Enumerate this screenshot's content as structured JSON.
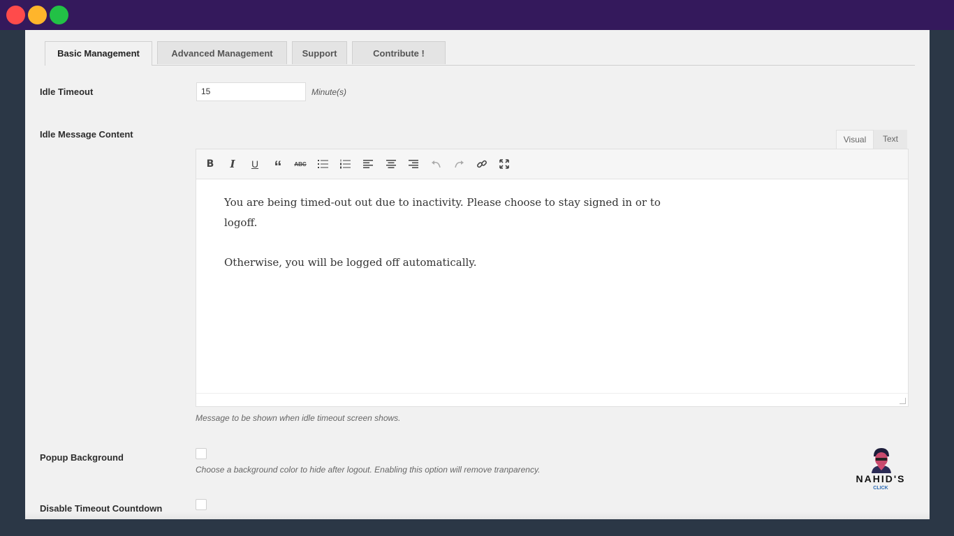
{
  "tabs": [
    {
      "label": "Basic Management",
      "active": true
    },
    {
      "label": "Advanced Management",
      "active": false
    },
    {
      "label": "Support",
      "active": false
    },
    {
      "label": "Contribute !",
      "active": false
    }
  ],
  "idle_timeout": {
    "label": "Idle Timeout",
    "value": "15",
    "unit": "Minute(s)"
  },
  "idle_message": {
    "label": "Idle Message Content",
    "mode_visual": "Visual",
    "mode_text": "Text",
    "toolbar": [
      "bold-icon",
      "italic-icon",
      "underline-icon",
      "blockquote-icon",
      "strikethrough-icon",
      "bullet-list-icon",
      "numbered-list-icon",
      "align-left-icon",
      "align-center-icon",
      "align-right-icon",
      "undo-icon",
      "redo-icon",
      "link-icon",
      "fullscreen-icon"
    ],
    "paragraph_1": "You are being timed-out out due to inactivity. Please choose to stay signed in or to logoff.",
    "paragraph_2": "Otherwise, you will be logged off automatically.",
    "hint": "Message to be shown when idle timeout screen shows."
  },
  "popup_background": {
    "label": "Popup Background",
    "hint": "Choose a background color to hide after logout. Enabling this option will remove tranparency."
  },
  "disable_countdown": {
    "label": "Disable Timeout Countdown"
  },
  "watermark": {
    "title": "NAHID'S",
    "sub": "CLICK"
  },
  "colors": {
    "titlebar": "#34195c",
    "background": "#2b3746",
    "close": "#ff4b4b",
    "minimize": "#ffb52b",
    "maximize": "#22c146"
  }
}
